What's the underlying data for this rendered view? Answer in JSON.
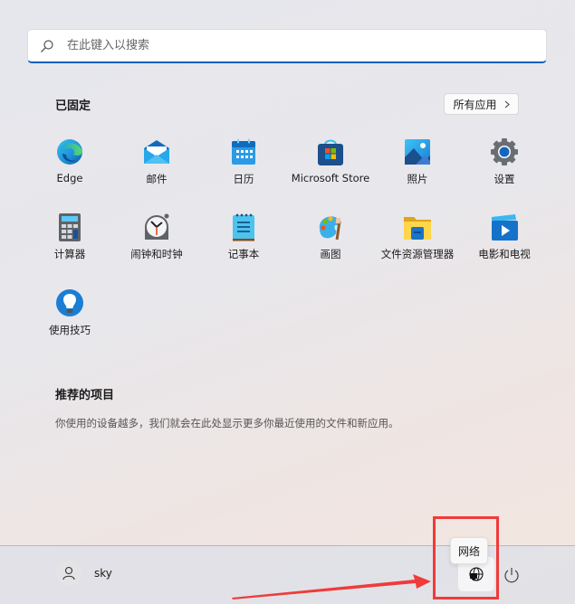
{
  "search": {
    "placeholder": "在此键入以搜索"
  },
  "pinned": {
    "title": "已固定",
    "all_apps_label": "所有应用",
    "apps": [
      {
        "label": "Edge",
        "icon": "edge-icon"
      },
      {
        "label": "邮件",
        "icon": "mail-icon"
      },
      {
        "label": "日历",
        "icon": "calendar-icon"
      },
      {
        "label": "Microsoft Store",
        "icon": "store-icon"
      },
      {
        "label": "照片",
        "icon": "photos-icon"
      },
      {
        "label": "设置",
        "icon": "settings-icon"
      },
      {
        "label": "计算器",
        "icon": "calculator-icon"
      },
      {
        "label": "闹钟和时钟",
        "icon": "clock-icon"
      },
      {
        "label": "记事本",
        "icon": "notepad-icon"
      },
      {
        "label": "画图",
        "icon": "paint-icon"
      },
      {
        "label": "文件资源管理器",
        "icon": "folder-icon"
      },
      {
        "label": "电影和电视",
        "icon": "movies-icon"
      },
      {
        "label": "使用技巧",
        "icon": "tips-icon"
      }
    ]
  },
  "recommended": {
    "title": "推荐的项目",
    "text": "你使用的设备越多，我们就会在此处显示更多你最近使用的文件和新应用。"
  },
  "footer": {
    "user_name": "sky",
    "network_tooltip": "网络"
  },
  "annotation": {
    "color": "#f03b3b"
  }
}
